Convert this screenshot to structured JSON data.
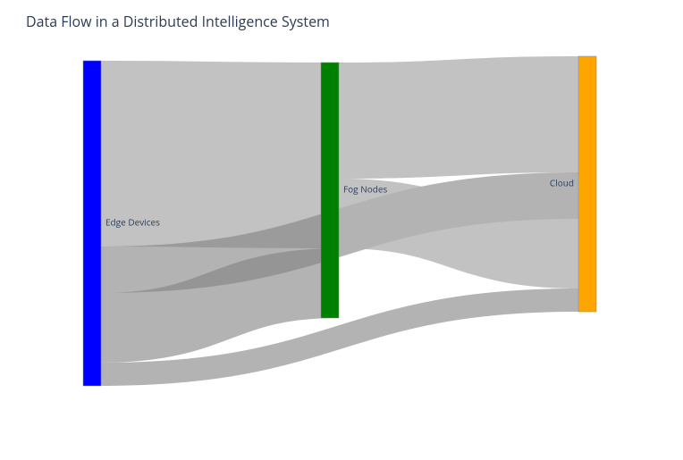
{
  "title": "Data Flow in a Distributed Intelligence System",
  "chart_data": {
    "type": "sankey",
    "nodes": [
      {
        "name": "Edge Devices",
        "color": "#0000ff"
      },
      {
        "name": "Fog Nodes",
        "color": "#008000"
      },
      {
        "name": "Cloud",
        "color": "#ffa500"
      }
    ],
    "links": [
      {
        "source": "Edge Devices",
        "target": "Fog Nodes",
        "value": 80,
        "color": "#b3b3b3",
        "opacity": 0.8
      },
      {
        "source": "Edge Devices",
        "target": "Cloud",
        "value": 20,
        "color": "#808080",
        "opacity": 0.6
      },
      {
        "source": "Fog Nodes",
        "target": "Cloud",
        "value": 50,
        "color": "#b3b3b3",
        "opacity": 0.8
      },
      {
        "source": "Fog Nodes",
        "target": "Edge Devices",
        "value": 30,
        "color": "#808080",
        "opacity": 0.6
      },
      {
        "source": "Cloud",
        "target": "Fog Nodes",
        "value": 30,
        "color": "#b3b3b3",
        "opacity": 0.8
      },
      {
        "source": "Cloud",
        "target": "Edge Devices",
        "value": 10,
        "color": "#808080",
        "opacity": 0.6
      }
    ]
  }
}
